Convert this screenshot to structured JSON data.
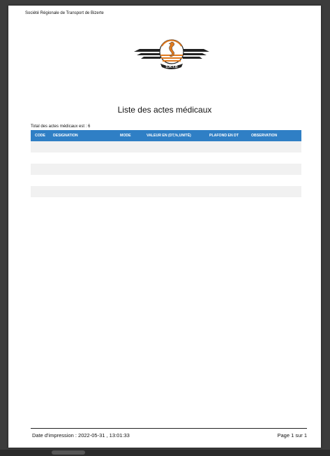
{
  "header": {
    "company": "Société Régionale de Transport de Bizerte",
    "logo_text": "S.R.T.B"
  },
  "document": {
    "title": "Liste des actes médicaux",
    "total_label": "Total des actes médicaux est : 6"
  },
  "table": {
    "columns": [
      "CODE",
      "DESIGNATION",
      "MODE",
      "VALEUR EN (DT,%,UNITÉ)",
      "PLAFOND EN DT",
      "OBSERVATION"
    ],
    "header_color": "#2f7fc5",
    "row_count": 6
  },
  "footer": {
    "print_date": "Date d'impression : 2022-05-31 , 13:01:33",
    "page": "Page 1 sur 1"
  }
}
